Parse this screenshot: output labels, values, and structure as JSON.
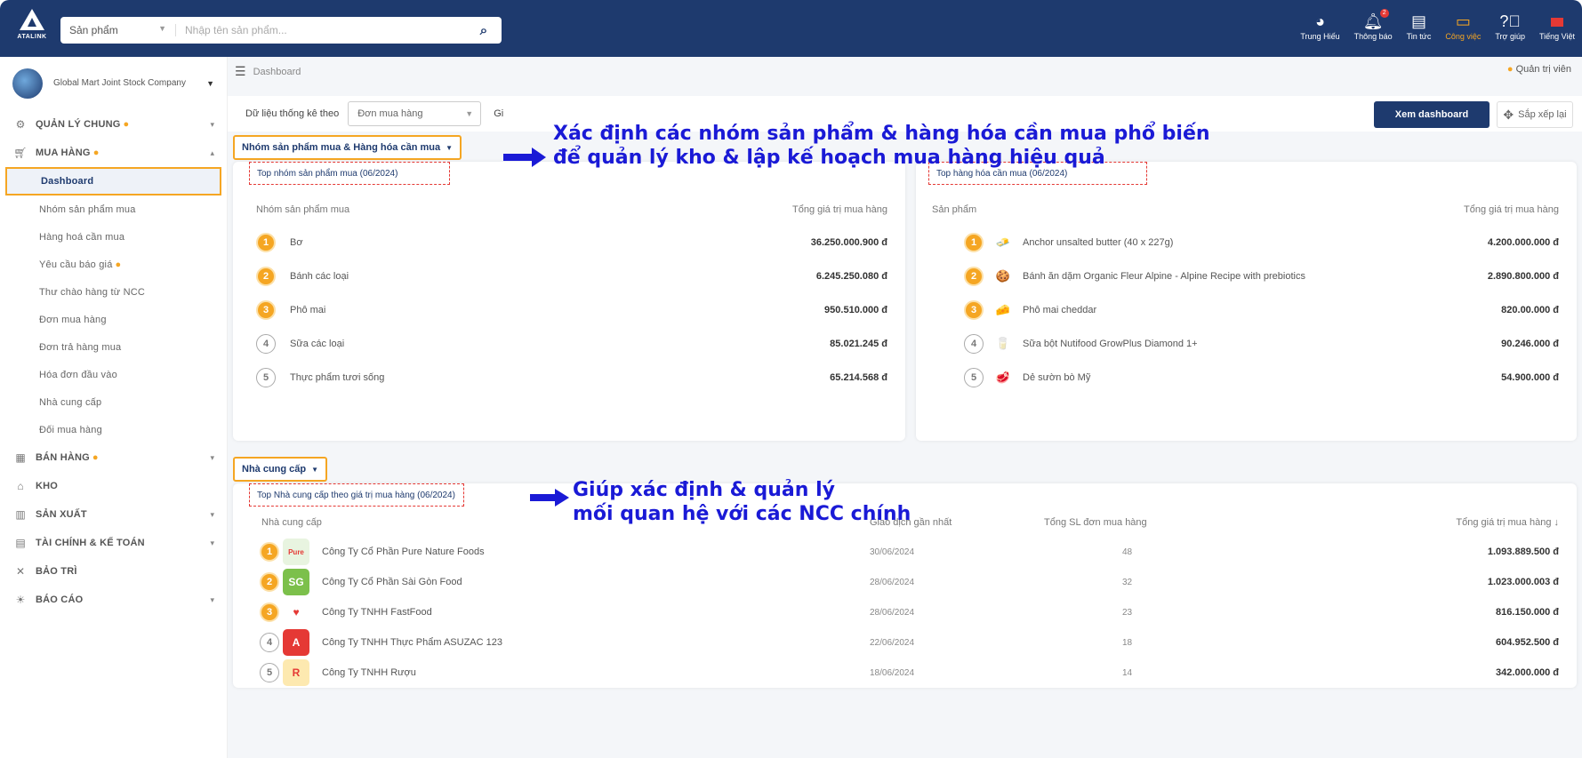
{
  "topbar": {
    "brand": "ATALINK",
    "search_category": "Sản phẩm",
    "search_placeholder": "Nhập tên sản phẩm...",
    "nav": [
      {
        "label": "Trung Hiếu",
        "icon": "user-icon"
      },
      {
        "label": "Thông báo",
        "icon": "bell-icon",
        "badge": "2"
      },
      {
        "label": "Tin tức",
        "icon": "news-icon"
      },
      {
        "label": "Công việc",
        "icon": "task-icon"
      },
      {
        "label": "Trợ giúp",
        "icon": "help-icon"
      },
      {
        "label": "Tiếng Việt",
        "icon": "flag-icon"
      }
    ]
  },
  "sidebar": {
    "company": "Global Mart Joint Stock Company",
    "items": [
      {
        "label": "QUẢN LÝ CHUNG",
        "dot": true,
        "chev": "▾"
      },
      {
        "label": "MUA HÀNG",
        "dot": true,
        "chev": "▴"
      }
    ],
    "sub": [
      "Dashboard",
      "Nhóm sản phẩm mua",
      "Hàng hoá cần mua",
      "Yêu cầu báo giá",
      "Thư chào hàng từ NCC",
      "Đơn mua hàng",
      "Đơn trả hàng mua",
      "Hóa đơn đầu vào",
      "Nhà cung cấp",
      "Đối mua hàng"
    ],
    "items2": [
      {
        "label": "BÁN HÀNG",
        "dot": true,
        "chev": "▾"
      },
      {
        "label": "KHO",
        "dot": false,
        "chev": ""
      },
      {
        "label": "SẢN XUẤT",
        "dot": false,
        "chev": "▾"
      },
      {
        "label": "TÀI CHÍNH & KẾ TOÁN",
        "dot": false,
        "chev": "▾"
      },
      {
        "label": "BẢO TRÌ",
        "dot": false,
        "chev": ""
      },
      {
        "label": "BÁO CÁO",
        "dot": false,
        "chev": "▾"
      }
    ]
  },
  "main": {
    "breadcrumb": "Dashboard",
    "role": "Quản trị viên",
    "filter_label": "Dữ liệu thống kê theo",
    "filter_value": "Đơn mua hàng",
    "filter_g": "Gi",
    "btn_dashboard": "Xem dashboard",
    "btn_sort": "Sắp xếp lại",
    "section1": "Nhóm sản phẩm mua & Hàng hóa cần mua",
    "section2": "Nhà cung cấp"
  },
  "card_groups": {
    "title": "Top nhóm sản phẩm mua (06/2024)",
    "col1": "Nhóm sản phẩm mua",
    "col2": "Tổng giá trị mua hàng",
    "rows": [
      {
        "rank": "1",
        "name": "Bơ",
        "value": "36.250.000.900 đ"
      },
      {
        "rank": "2",
        "name": "Bánh các loại",
        "value": "6.245.250.080 đ"
      },
      {
        "rank": "3",
        "name": "Phô mai",
        "value": "950.510.000 đ"
      },
      {
        "rank": "4",
        "name": "Sữa các loại",
        "value": "85.021.245 đ"
      },
      {
        "rank": "5",
        "name": "Thực phẩm tươi sống",
        "value": "65.214.568 đ"
      }
    ]
  },
  "card_goods": {
    "title": "Top hàng hóa cần mua (06/2024)",
    "col1": "Sản phẩm",
    "col2": "Tổng giá trị mua hàng",
    "rows": [
      {
        "rank": "1",
        "name": "Anchor unsalted butter (40 x 227g)",
        "value": "4.200.000.000 đ",
        "thumb": "🧈"
      },
      {
        "rank": "2",
        "name": "Bánh ăn dặm Organic Fleur Alpine - Alpine Recipe with prebiotics",
        "value": "2.890.800.000 đ",
        "thumb": "🍪"
      },
      {
        "rank": "3",
        "name": "Phô mai cheddar",
        "value": "820.00.000 đ",
        "thumb": "🧀"
      },
      {
        "rank": "4",
        "name": "Sữa bột Nutifood GrowPlus Diamond 1+",
        "value": "90.246.000 đ",
        "thumb": "🥛"
      },
      {
        "rank": "5",
        "name": "Dẻ sườn bò Mỹ",
        "value": "54.900.000 đ",
        "thumb": "🥩"
      }
    ]
  },
  "card_suppliers": {
    "title": "Top Nhà cung cấp theo giá trị mua hàng (06/2024)",
    "col1": "Nhà cung cấp",
    "col2": "Giao dịch gần nhất",
    "col3": "Tổng SL đơn mua hàng",
    "col4": "Tổng giá trị mua hàng ↓",
    "rows": [
      {
        "rank": "1",
        "name": "Công Ty Cổ Phần Pure Nature Foods",
        "date": "30/06/2024",
        "count": "48",
        "value": "1.093.889.500 đ",
        "logo": "Pure",
        "color": "#e8f4e0"
      },
      {
        "rank": "2",
        "name": "Công Ty Cổ Phần Sài Gòn Food",
        "date": "28/06/2024",
        "count": "32",
        "value": "1.023.000.003 đ",
        "logo": "SG",
        "color": "#7cc04b"
      },
      {
        "rank": "3",
        "name": "Công Ty TNHH FastFood",
        "date": "28/06/2024",
        "count": "23",
        "value": "816.150.000 đ",
        "logo": "♥",
        "color": "#fff"
      },
      {
        "rank": "4",
        "name": "Công Ty TNHH Thực Phẩm ASUZAC 123",
        "date": "22/06/2024",
        "count": "18",
        "value": "604.952.500 đ",
        "logo": "A",
        "color": "#e53935"
      },
      {
        "rank": "5",
        "name": "Công Ty TNHH Rượu",
        "date": "18/06/2024",
        "count": "14",
        "value": "342.000.000 đ",
        "logo": "R",
        "color": "#fde9b0"
      }
    ]
  },
  "callouts": {
    "c1_line1": "Xác định các nhóm sản phẩm & hàng hóa cần mua phổ biến",
    "c1_line2": "để quản lý kho & lập kế hoạch mua hàng hiệu quả",
    "c2_line1": "Giúp xác định & quản lý",
    "c2_line2": "mối quan hệ với các NCC chính"
  },
  "colors": {
    "navy": "#1e3a6e",
    "accent": "#f5a623",
    "callout": "#1a1ad6",
    "dashed": "#e53935"
  }
}
